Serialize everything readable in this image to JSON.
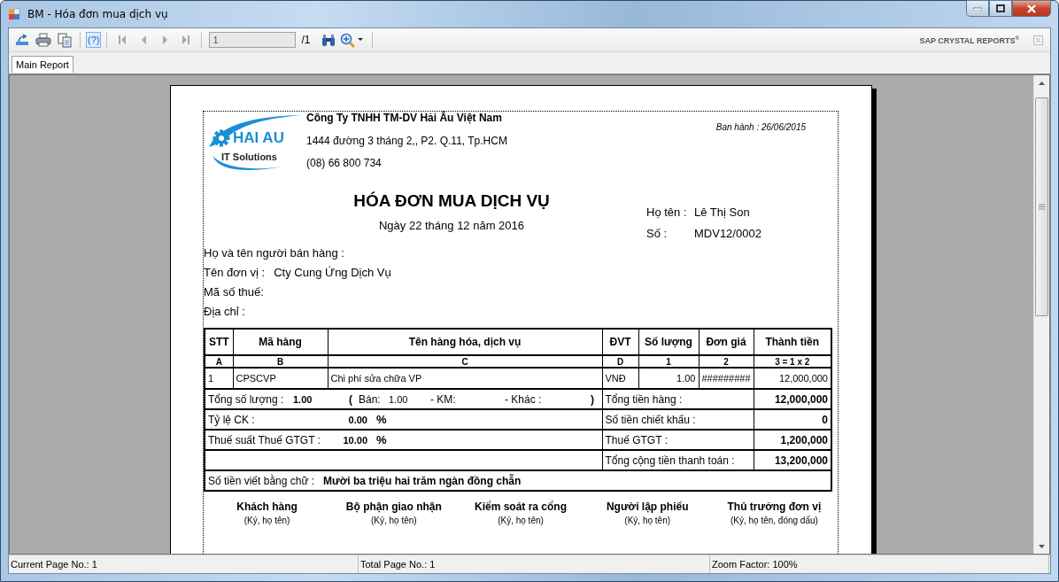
{
  "window": {
    "title": "BM - Hóa đơn mua dịch vụ"
  },
  "toolbar": {
    "help": "(?)",
    "page": "1",
    "page_total": "/1",
    "brand": "SAP CRYSTAL REPORTS$^{®}$"
  },
  "tabs": [
    {
      "label": "Main Report",
      "selected": true
    }
  ],
  "report": {
    "logo": {
      "title": "HAI AU",
      "subtitle": "IT Solutions"
    },
    "company": {
      "name": "Công Ty TNHH TM-DV Hải Âu Việt Nam",
      "address": "1444 đường 3 tháng 2,, P2. Q.11, Tp.HCM",
      "phone": "(08) 66 800 734"
    },
    "issued": "Ban hành : 26/06/2015",
    "title": "HÓA ĐƠN MUA DỊCH VỤ",
    "date": "Ngày 22 tháng 12 năm 2016",
    "buyer": [
      {
        "label": "Họ tên :",
        "value": "Lê Thị Son"
      },
      {
        "label": "Số :",
        "value": "MDV12/0002"
      }
    ],
    "seller": [
      {
        "label": "Họ và tên người bán hàng :"
      },
      {
        "label": "Tên đơn vị :",
        "value": "Cty Cung Ứng Dịch Vụ"
      },
      {
        "label": "Mã số thuế:"
      },
      {
        "label": "Địa chỉ :"
      }
    ],
    "table": {
      "columns": [
        "STT",
        "Mã hàng",
        "Tên hàng hóa, dịch vụ",
        "ĐVT",
        "Số lượng",
        "Đơn giá",
        "Thành tiền"
      ],
      "codes": [
        "A",
        "B",
        "C",
        "D",
        "1",
        "2",
        "3 = 1 x 2"
      ],
      "rows": [
        [
          "1",
          "CPSCVP",
          "Chi phí sửa chữa VP",
          "VNĐ",
          "1.00",
          "#########",
          "12,000,000"
        ]
      ]
    },
    "summary": [
      {
        "kind": "quantity",
        "parts": [
          "Tổng số lượng :",
          "1.00",
          "(",
          "Bán:",
          "1.00",
          "- KM:",
          "- Khác :",
          ")"
        ],
        "label": "Tổng tiền hàng :",
        "amount": "12,000,000"
      },
      {
        "kind": "rate",
        "parts": [
          "Tỷ lệ CK :",
          "0.00",
          "%"
        ],
        "label": "Số tiền chiết khấu :",
        "amount": "0"
      },
      {
        "kind": "rate",
        "parts": [
          "Thuế suất Thuế GTGT :",
          "10.00",
          "%"
        ],
        "label": "Thuế GTGT :",
        "amount": "1,200,000"
      },
      {
        "kind": "blank",
        "label": "Tổng cộng tiền thanh toán :",
        "amount": "13,200,000"
      }
    ],
    "amount_in_words": {
      "label": "Số tiền viết bằng chữ :",
      "value": "Mười ba triệu hai trăm ngàn đồng chẵn"
    },
    "signatures": [
      {
        "role": "Khách hàng",
        "note": "(Ký, họ tên)"
      },
      {
        "role": "Bộ phận giao nhận",
        "note": "(Ký, họ tên)"
      },
      {
        "role": "Kiểm soát ra cổng",
        "note": "(Ký, họ tên)"
      },
      {
        "role": "Người lập phiếu",
        "note": "(Ký, họ tên)"
      },
      {
        "role": "Thủ trưởng đơn vị",
        "note": "(Ký, họ tên, đóng dấu)"
      }
    ]
  },
  "status_bar": [
    "Current Page No.: 1",
    "Total Page No.: 1",
    "Zoom Factor: 100%"
  ]
}
